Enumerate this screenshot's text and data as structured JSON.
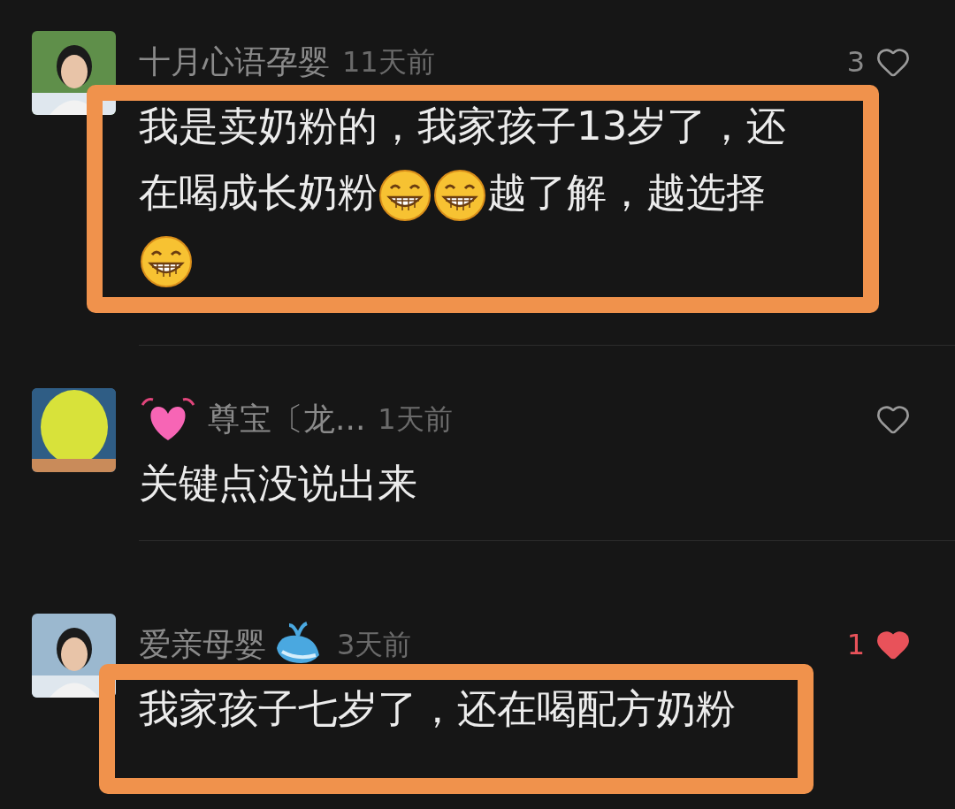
{
  "comments": [
    {
      "name": "十月心语孕婴",
      "time": "11天前",
      "likes": "3",
      "liked": false,
      "highlighted": true,
      "badge_before": false,
      "badge_after": false,
      "segments": [
        {
          "kind": "text",
          "text": "我是卖奶粉的，我家孩子13岁了，还"
        },
        {
          "kind": "text",
          "text": "在喝成长奶粉"
        },
        {
          "kind": "emoji"
        },
        {
          "kind": "emoji"
        },
        {
          "kind": "text",
          "text": "越了解，越选择"
        },
        {
          "kind": "emoji"
        }
      ]
    },
    {
      "name": "尊宝〔龙...",
      "time": "1天前",
      "liked": false,
      "highlighted": false,
      "badge_before": true,
      "badge_after": false,
      "segments": [
        {
          "kind": "text",
          "text": "关键点没说出来"
        }
      ]
    },
    {
      "name": "爱亲母婴",
      "time": "3天前",
      "likes": "1",
      "liked": true,
      "highlighted": true,
      "badge_before": false,
      "badge_after": true,
      "segments": [
        {
          "kind": "text",
          "text": "我家孩子七岁了，还在喝配方奶粉"
        }
      ]
    }
  ]
}
